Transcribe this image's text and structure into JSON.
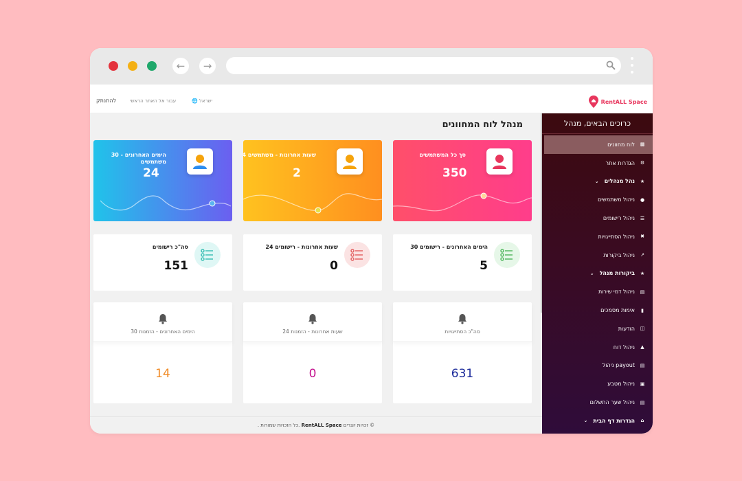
{
  "header": {
    "logout": "להתנתק",
    "goto_main": "עבור אל האתר הראשי",
    "language": "ישראל",
    "brand": "RentALL Space"
  },
  "sidebar": {
    "welcome": "כרוכים הבאים, מנהל",
    "items": [
      {
        "label": "לוח מחוונים",
        "icon": "chart-icon",
        "active": true
      },
      {
        "label": "הגדרות אתר",
        "icon": "gear-icon"
      },
      {
        "label": "נהל מנהלים",
        "icon": "star-icon",
        "section": true
      },
      {
        "label": "ניהול משתמשים",
        "icon": "user-icon"
      },
      {
        "label": "ניהול רישומים",
        "icon": "list-icon"
      },
      {
        "label": "ניהול הסתייגויות",
        "icon": "cross-icon"
      },
      {
        "label": "ניהול ביקורות",
        "icon": "trend-icon"
      },
      {
        "label": "ביקורות מנהל",
        "icon": "star-icon",
        "section": true
      },
      {
        "label": "ניהול דמי שירות",
        "icon": "card-icon"
      },
      {
        "label": "אימות מסמכים",
        "icon": "file-icon"
      },
      {
        "label": "הודעות",
        "icon": "inbox-icon"
      },
      {
        "label": "ניהול דוח",
        "icon": "lock-icon"
      },
      {
        "label": "ניהול payout",
        "icon": "card-icon"
      },
      {
        "label": "ניהול מטבע",
        "icon": "money-icon"
      },
      {
        "label": "ניהול שער התשלום",
        "icon": "card-icon"
      },
      {
        "label": "הגדרות דף הבית",
        "icon": "home-icon",
        "section": true
      }
    ]
  },
  "main": {
    "title": "מנהל לוח המחוונים",
    "gradient_cards": [
      {
        "label": "סך כל המשתמשים",
        "value": "350",
        "colors": [
          "#ff4f6a",
          "#ff3d8b"
        ]
      },
      {
        "label": "24 שעות אחרונות - משתמשים",
        "value": "2",
        "colors": [
          "#ffc21f",
          "#ff8f1f"
        ]
      },
      {
        "label": "30 הימים האחרונים - משתמשים",
        "value": "24",
        "colors": [
          "#20c3ea",
          "#6b5ff0"
        ]
      }
    ],
    "stat_cards": [
      {
        "label": "30 הימים האחרונים - רישומים",
        "value": "5",
        "tint": "#e6f7e8",
        "icon_color": "#41b04f"
      },
      {
        "label": "24 שעות אחרונות - רישומים",
        "value": "0",
        "tint": "#fbe3e3",
        "icon_color": "#e05151"
      },
      {
        "label": "סה\"כ רישומים",
        "value": "151",
        "tint": "#dff7f5",
        "icon_color": "#27b9ad"
      }
    ],
    "booking_cards": [
      {
        "label": "סה\"כ הסתייגויות",
        "value": "631",
        "color": "#1b2a9a"
      },
      {
        "label": "24 שעות אחרונות - הזמנות",
        "value": "0",
        "color": "#c4128f"
      },
      {
        "label": "30 הימים האחרונים - הזמנות",
        "value": "14",
        "color": "#f08a24"
      }
    ]
  },
  "footer": {
    "prefix": "זכויות יוצרים ©",
    "brand": "RentALL Space",
    "suffix": ". כל הזכויות שמורות."
  }
}
